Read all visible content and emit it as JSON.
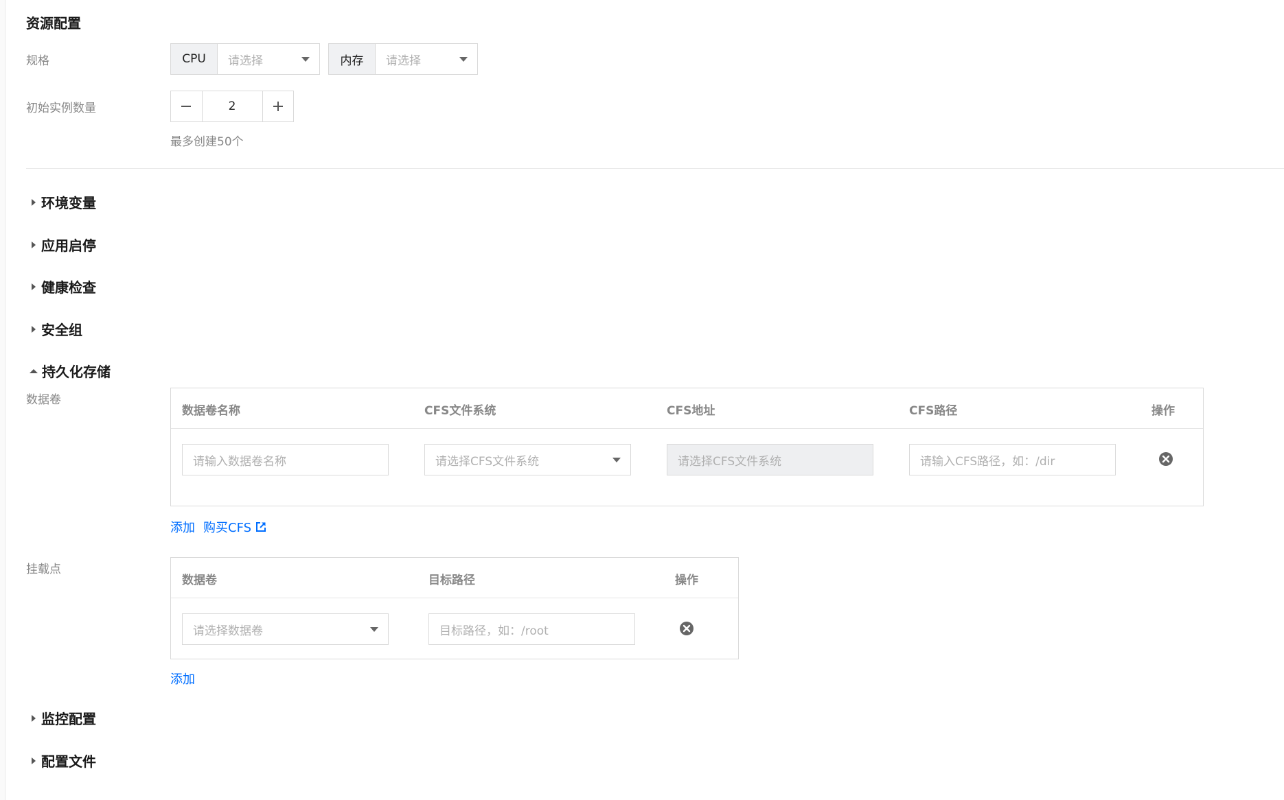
{
  "resource": {
    "title": "资源配置",
    "spec_label": "规格",
    "cpu_label": "CPU",
    "cpu_placeholder": "请选择",
    "mem_label": "内存",
    "mem_placeholder": "请选择",
    "instances_label": "初始实例数量",
    "instances_value": "2",
    "instances_hint": "最多创建50个"
  },
  "sections_top": [
    "环境变量",
    "应用启停",
    "健康检查",
    "安全组"
  ],
  "storage": {
    "title": "持久化存储",
    "volumes_label": "数据卷",
    "volumes_table": {
      "headers": [
        "数据卷名称",
        "CFS文件系统",
        "CFS地址",
        "CFS路径",
        "操作"
      ],
      "row": {
        "name_placeholder": "请输入数据卷名称",
        "fs_placeholder": "请选择CFS文件系统",
        "addr_placeholder": "请选择CFS文件系统",
        "path_placeholder": "请输入CFS路径，如：/dir"
      }
    },
    "add_label": "添加",
    "buy_cfs_label": "购买CFS",
    "mount_label": "挂载点",
    "mount_table": {
      "headers": [
        "数据卷",
        "目标路径",
        "操作"
      ],
      "row": {
        "volume_placeholder": "请选择数据卷",
        "target_placeholder": "目标路径，如：/root"
      }
    },
    "mount_add_label": "添加"
  },
  "sections_bottom": [
    "监控配置",
    "配置文件"
  ],
  "colors": {
    "link": "#006eff",
    "border": "#d9d9d9",
    "label": "#888888"
  }
}
